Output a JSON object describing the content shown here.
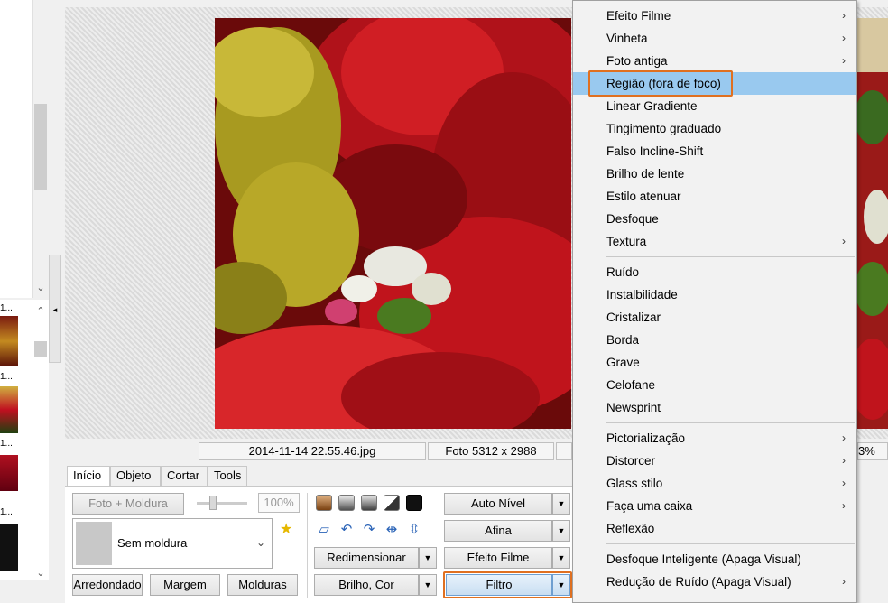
{
  "left_panel": {
    "thumb_captions": [
      "1...",
      "1...",
      "1...",
      "1..."
    ]
  },
  "status": {
    "filename": "2014-11-14 22.55.46.jpg",
    "dimensions": "Foto 5312 x 2988",
    "zoom_partial": "3%"
  },
  "tabs": [
    "Início",
    "Objeto",
    "Cortar",
    "Tools"
  ],
  "toolbar": {
    "foto_moldura": "Foto + Moldura",
    "zoom_percent": "100%",
    "frame_select": "Sem moldura",
    "arredondado": "Arredondado",
    "margem": "Margem",
    "molduras": "Molduras",
    "redimensionar": "Redimensionar",
    "brilho_cor": "Brilho, Cor",
    "auto_nivel": "Auto Nível",
    "afina": "Afina",
    "efeito_filme": "Efeito Filme",
    "filtro": "Filtro"
  },
  "menu": {
    "group1": [
      {
        "label": "Efeito Filme",
        "submenu": true
      },
      {
        "label": "Vinheta",
        "submenu": true
      },
      {
        "label": "Foto antiga",
        "submenu": true
      },
      {
        "label": "Região (fora de foco)",
        "submenu": false,
        "highlighted": true
      },
      {
        "label": "Linear Gradiente",
        "submenu": false
      },
      {
        "label": "Tingimento graduado",
        "submenu": false
      },
      {
        "label": "Falso Incline-Shift",
        "submenu": false
      },
      {
        "label": "Brilho de lente",
        "submenu": false
      },
      {
        "label": "Estilo atenuar",
        "submenu": false
      },
      {
        "label": "Desfoque",
        "submenu": false
      },
      {
        "label": "Textura",
        "submenu": true
      }
    ],
    "group2": [
      {
        "label": "Ruído",
        "submenu": false
      },
      {
        "label": "Instalbilidade",
        "submenu": false
      },
      {
        "label": "Cristalizar",
        "submenu": false
      },
      {
        "label": "Borda",
        "submenu": false
      },
      {
        "label": "Grave",
        "submenu": false
      },
      {
        "label": "Celofane",
        "submenu": false
      },
      {
        "label": "Newsprint",
        "submenu": false
      }
    ],
    "group3": [
      {
        "label": "Pictorialização",
        "submenu": true
      },
      {
        "label": "Distorcer",
        "submenu": true
      },
      {
        "label": "Glass stilo",
        "submenu": true
      },
      {
        "label": "Faça uma caixa",
        "submenu": true
      },
      {
        "label": "Reflexão",
        "submenu": false
      }
    ],
    "group4": [
      {
        "label": "Desfoque Inteligente (Apaga Visual)",
        "submenu": false
      },
      {
        "label": "Redução de Ruído (Apaga Visual)",
        "submenu": true
      }
    ]
  },
  "colors": {
    "highlight": "#99c9ef",
    "callout": "#e07020"
  }
}
